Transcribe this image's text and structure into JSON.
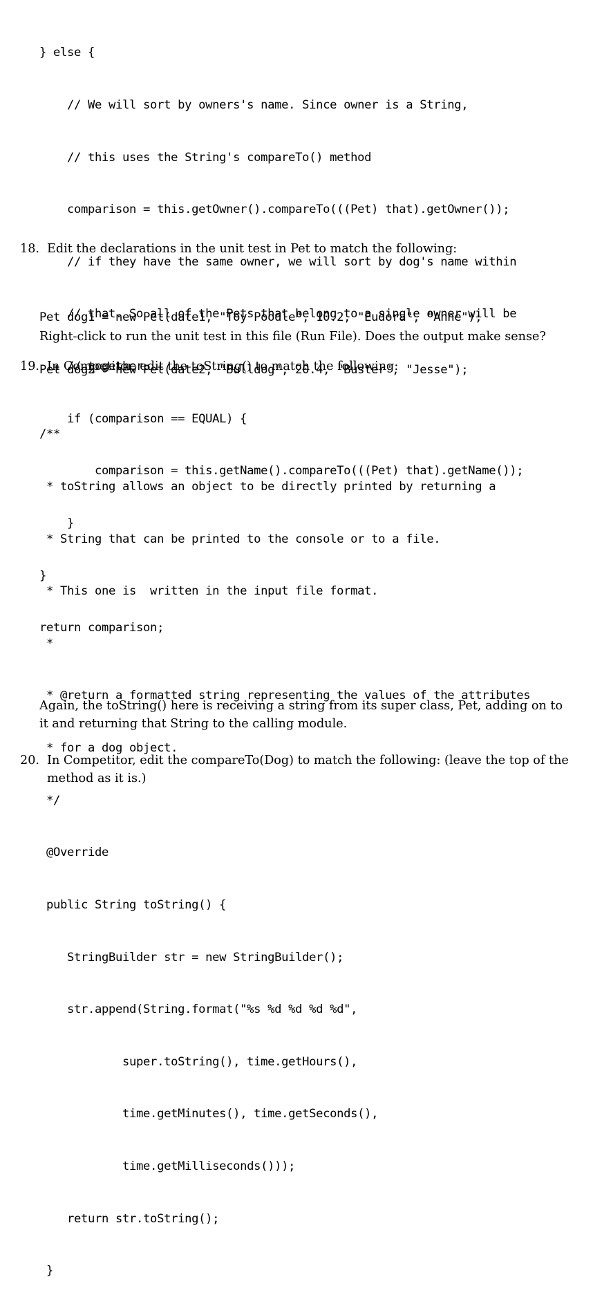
{
  "document": {
    "type": "lab-handout-page",
    "font_style": "latex-computer-modern"
  },
  "blocks": {
    "code_compareto_else": {
      "lines": [
        "} else {",
        "    // We will sort by owners's name. Since owner is a String,",
        "    // this uses the String's compareTo() method",
        "    comparison = this.getOwner().compareTo(((Pet) that).getOwner());",
        "    // if they have the same owner, we will sort by dog's name within",
        "    // that. So all of the Pets that belong to a single owner will be",
        "    // together",
        "    if (comparison == EQUAL) {",
        "        comparison = this.getName().compareTo(((Pet) that).getName());",
        "    }",
        "}",
        "return comparison;"
      ]
    },
    "code_declarations": {
      "lines": [
        "Pet dog1 = new Pet(date1, \"Toy Poodle\", 10.2, \"Eudora\", \"Anne\");",
        "Pet dog2 = new Pet(date2, \"Bulldog\", 20.4, \"Buster\", \"Jesse\");"
      ]
    },
    "code_tostring": {
      "lines": [
        "/**",
        " * toString allows an object to be directly printed by returning a",
        " * String that can be printed to the console or to a file.",
        " * This one is  written in the input file format.",
        " *",
        " * @return a formatted string representing the values of the attributes",
        " * for a dog object.",
        " */",
        " @Override",
        " public String toString() {",
        "    StringBuilder str = new StringBuilder();",
        "    str.append(String.format(\"%s %d %d %d %d\",",
        "            super.toString(), time.getHours(),",
        "            time.getMinutes(), time.getSeconds(),",
        "            time.getMilliseconds()));",
        "    return str.toString();",
        " }"
      ]
    }
  },
  "items": [
    {
      "number": "18.",
      "intro": "Edit the declarations in the unit test in Pet to match the following:",
      "followup": "Right-click to run the unit test in this file (Run File).  Does the output make sense?"
    },
    {
      "number": "19.",
      "intro": "In Competitor, edit the toString() to match the following:",
      "followup_line1": "Again, the toString() here is receiving a string from its super class, Pet, adding on to",
      "followup_line2": "it and returning that String to the calling module."
    },
    {
      "number": "20.",
      "intro_line1": "In Competitor, edit the compareTo(Dog) to match the following: (leave the top of the",
      "intro_line2": "method as it is.)"
    }
  ]
}
